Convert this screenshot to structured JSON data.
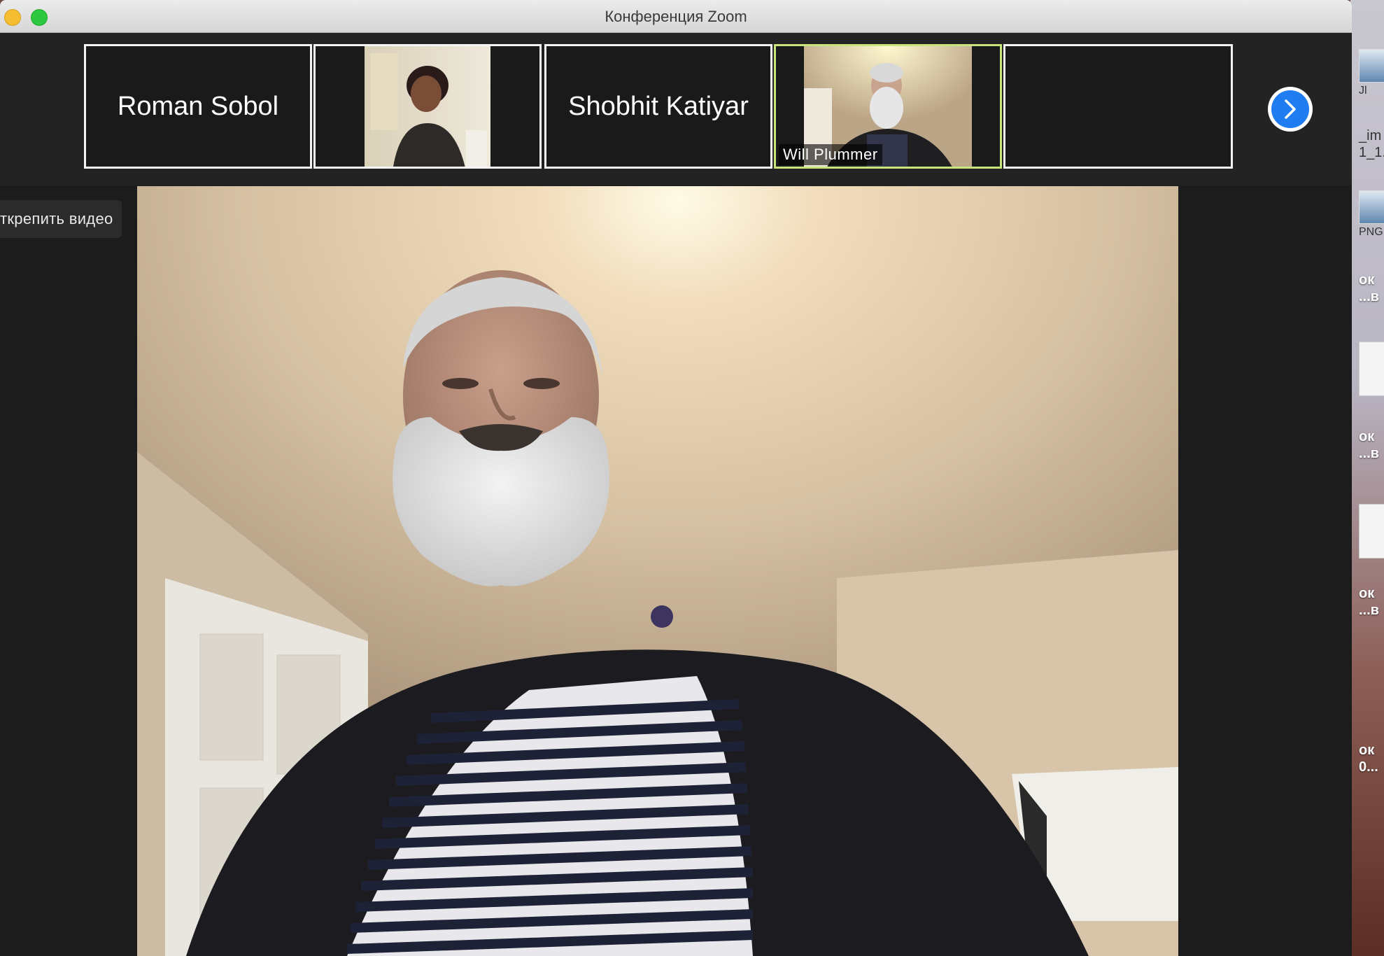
{
  "window": {
    "title": "Конференция Zoom"
  },
  "participants": [
    {
      "name": "Roman Sobol",
      "video": false,
      "speaking": false
    },
    {
      "name": "",
      "video": true,
      "speaking": false
    },
    {
      "name": "Shobhit Katiyar",
      "video": false,
      "speaking": false
    },
    {
      "name": "Will Plummer",
      "video": true,
      "speaking": true
    },
    {
      "name": "",
      "video": false,
      "speaking": false
    }
  ],
  "tooltip": {
    "unpin_text": "ткрепить видео"
  },
  "desktop": {
    "labels": [
      "Jl",
      "_im",
      "1_1.",
      "PNG",
      "ок",
      "...в",
      "ок",
      "...в",
      "ок",
      "...в",
      "ок",
      "0..."
    ]
  },
  "colors": {
    "active_speaker_border": "#c7e57a",
    "next_button": "#1f7cf1"
  }
}
